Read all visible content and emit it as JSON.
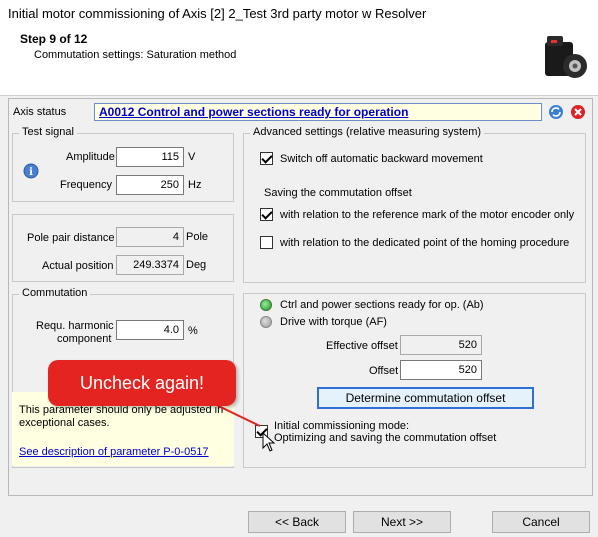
{
  "window": {
    "title": "Initial motor commissioning of Axis [2] 2_Test 3rd party motor w Resolver"
  },
  "header": {
    "step": "Step 9 of 12",
    "subtitle": "Commutation settings: Saturation method",
    "motor_icon": "servo-motor-icon"
  },
  "axis_status": {
    "label": "Axis status",
    "value": "A0012 Control and power sections ready for operation"
  },
  "test_signal": {
    "title": "Test signal",
    "amplitude_label": "Amplitude",
    "amplitude_value": "115",
    "amplitude_unit": "V",
    "frequency_label": "Frequency",
    "frequency_value": "250",
    "frequency_unit": "Hz"
  },
  "pole": {
    "pole_pair_label": "Pole pair distance",
    "pole_pair_value": "4",
    "pole_pair_unit": "Pole",
    "position_label": "Actual position",
    "position_value": "249.3374",
    "position_unit": "Deg"
  },
  "commutation": {
    "title": "Commutation",
    "harmonic_label_1": "Requ. harmonic",
    "harmonic_label_2": "component",
    "harmonic_value": "4.0",
    "harmonic_unit": "%"
  },
  "info": {
    "text_1": "This parameter should only be adjusted in",
    "text_2": "exceptional cases.",
    "link": "See description of parameter P-0-0517"
  },
  "advanced": {
    "title": "Advanced settings (relative measuring system)",
    "switch_off_label": "Switch off automatic backward movement",
    "switch_off_checked": true,
    "saving_label": "Saving the commutation offset",
    "ref_mark_label": "with relation to the reference mark of the motor encoder only",
    "ref_mark_checked": true,
    "homing_label": "with relation to the dedicated point of the homing procedure",
    "homing_checked": false
  },
  "offset": {
    "ready_label": "Ctrl and power sections ready for op. (Ab)",
    "torque_label": "Drive with torque (AF)",
    "effective_label": "Effective offset",
    "effective_value": "520",
    "offset_label": "Offset",
    "offset_value": "520",
    "determine_label": "Determine commutation offset",
    "initial_mode_1": "Initial commissioning mode:",
    "initial_mode_2": "Optimizing and saving the commutation offset",
    "initial_mode_checked": true
  },
  "callout": {
    "text": "Uncheck again!",
    "color": "#e32420"
  },
  "footer": {
    "back_label": "<< Back",
    "next_label": "Next >>",
    "cancel_label": "Cancel"
  }
}
